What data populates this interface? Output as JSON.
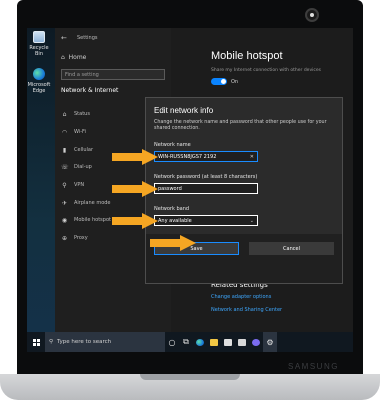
{
  "device": {
    "brand": "SAMSUNG"
  },
  "desktop": {
    "icons": [
      {
        "label": "Recycle Bin",
        "icon": "recycle-bin-icon"
      },
      {
        "label": "Microsoft Edge",
        "icon": "edge-icon"
      }
    ]
  },
  "settings": {
    "window_title": "Settings",
    "home": "Home",
    "search_placeholder": "Find a setting",
    "section": "Network & Internet",
    "nav_items": [
      {
        "label": "Status",
        "icon": "status-icon"
      },
      {
        "label": "Wi-Fi",
        "icon": "wifi-icon"
      },
      {
        "label": "Cellular",
        "icon": "cellular-icon"
      },
      {
        "label": "Dial-up",
        "icon": "dialup-icon"
      },
      {
        "label": "VPN",
        "icon": "vpn-icon"
      },
      {
        "label": "Airplane mode",
        "icon": "airplane-icon"
      },
      {
        "label": "Mobile hotspot",
        "icon": "hotspot-icon"
      },
      {
        "label": "Proxy",
        "icon": "proxy-icon"
      }
    ],
    "page_title": "Mobile hotspot",
    "share_desc": "Share my Internet connection with other devices",
    "toggle_label": "On",
    "related_heading": "Related settings",
    "related_links": [
      "Change adapter options",
      "Network and Sharing Center"
    ]
  },
  "dialog": {
    "title": "Edit network info",
    "description": "Change the network name and password that other people use for your shared connection.",
    "network_name_label": "Network name",
    "network_name_value": "WIN-RU5SN8JGS7 2192",
    "network_password_label": "Network password (at least 8 characters)",
    "network_password_value": "password",
    "network_band_label": "Network band",
    "network_band_value": "Any available",
    "save_label": "Save",
    "cancel_label": "Cancel"
  },
  "taskbar": {
    "search_placeholder": "Type here to search",
    "icons": [
      "cortana-icon",
      "task-view-icon",
      "edge-icon",
      "file-explorer-icon",
      "store-icon",
      "mail-icon",
      "app-icon",
      "settings-icon"
    ]
  },
  "colors": {
    "accent": "#1a8cff",
    "arrow": "#f5a623",
    "dialog_bg": "#2b2b2b"
  }
}
